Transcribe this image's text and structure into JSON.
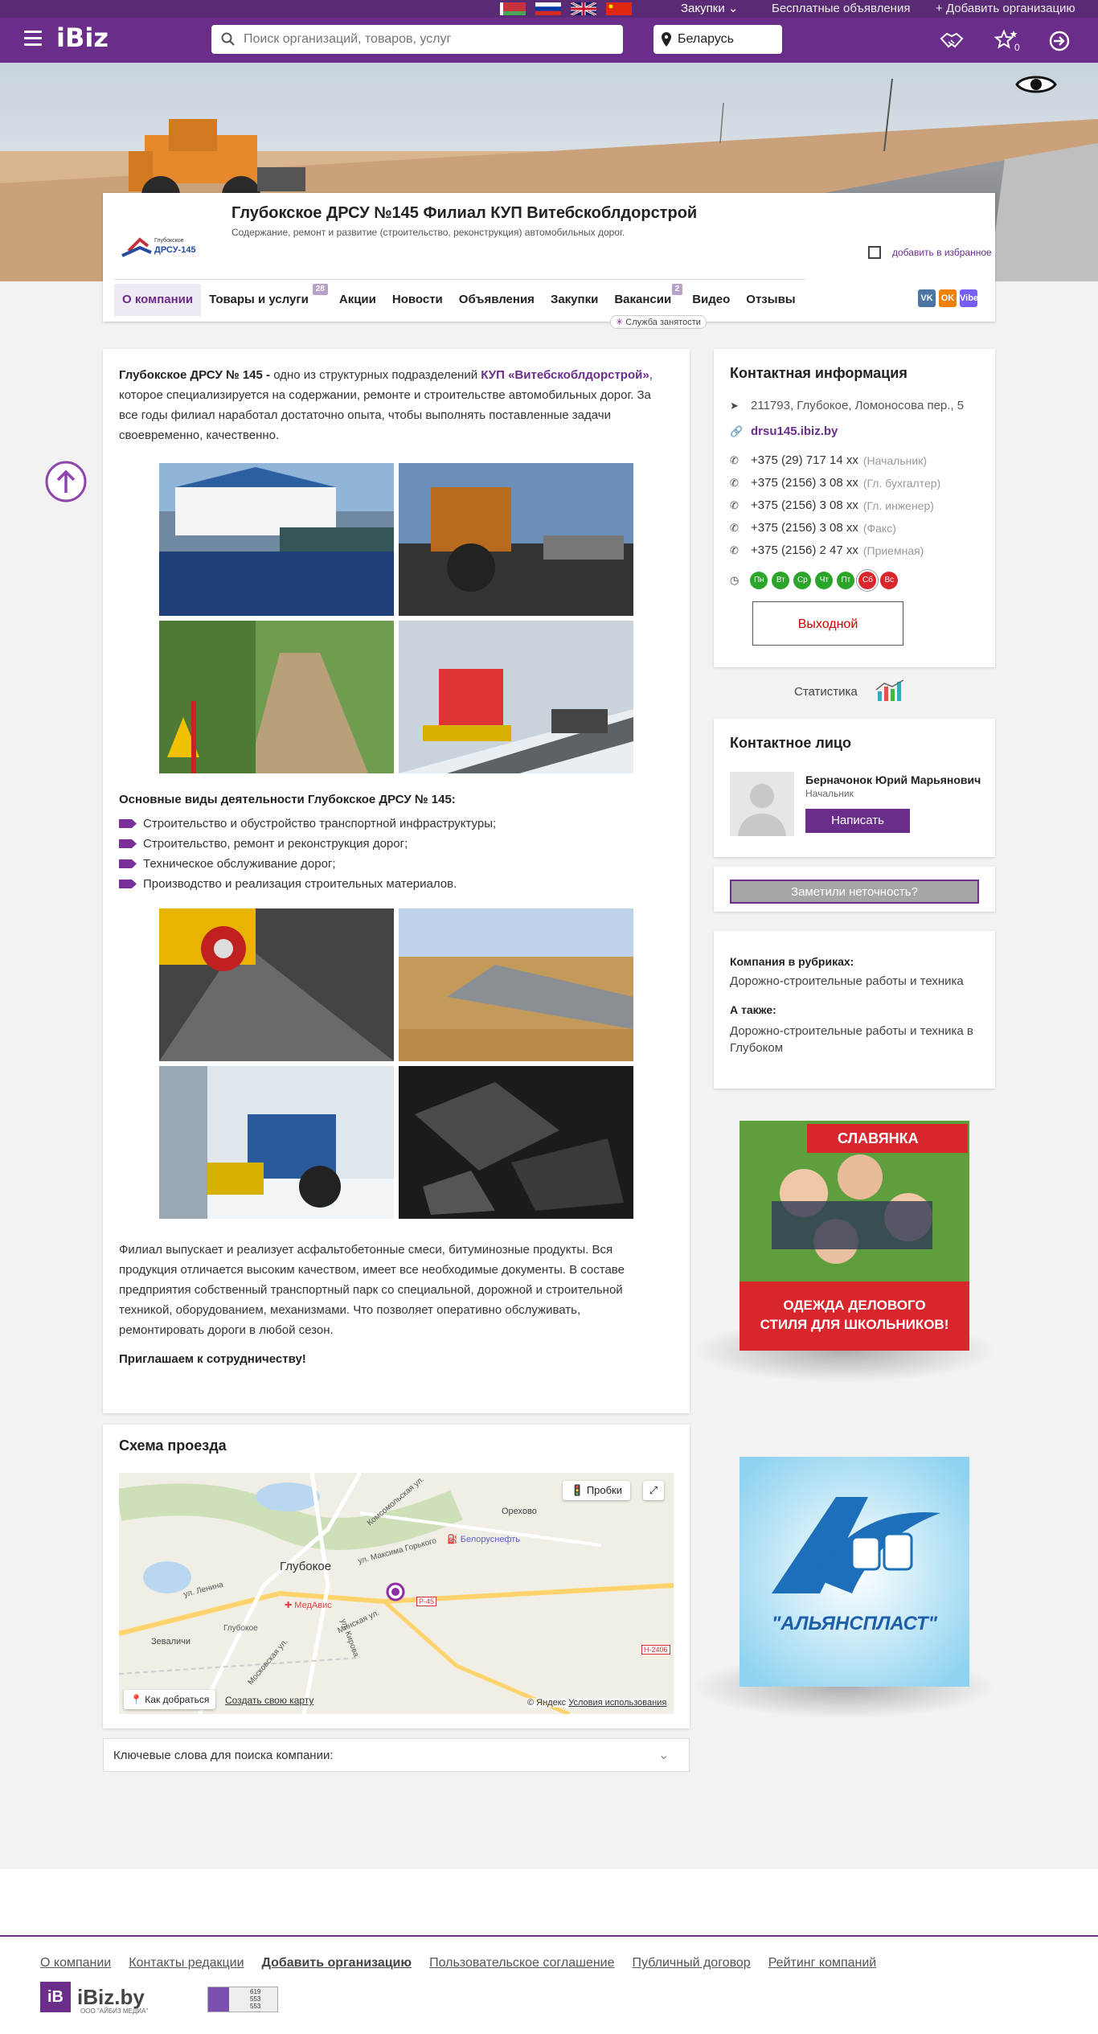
{
  "topbar": {
    "purchases": "Закупки",
    "free_ads": "Бесплатные объявления",
    "add_org": "Добавить организацию"
  },
  "header": {
    "logo": "iBiz",
    "search_placeholder": "Поиск организаций, товаров, услуг",
    "region": "Беларусь",
    "favorites_count": "0"
  },
  "company": {
    "title": "Глубокское ДРСУ №145 Филиал КУП Витебскоблдорстрой",
    "subtitle": "Содержание, ремонт и развитие (строительство, реконструкция) автомобильных дорог.",
    "logo_text_small": "Глубокское",
    "logo_text_big": "ДРСУ-145",
    "add_favorite": "добавить в избранное"
  },
  "tabs": [
    {
      "label": "О компании",
      "badge": ""
    },
    {
      "label": "Товары и услуги",
      "badge": "28"
    },
    {
      "label": "Акции",
      "badge": ""
    },
    {
      "label": "Новости",
      "badge": ""
    },
    {
      "label": "Объявления",
      "badge": ""
    },
    {
      "label": "Закупки",
      "badge": ""
    },
    {
      "label": "Вакансии",
      "badge": "2"
    },
    {
      "label": "Видео",
      "badge": ""
    },
    {
      "label": "Отзывы",
      "badge": ""
    }
  ],
  "tooltip": "Служба занятости",
  "socials": [
    "VK",
    "OK",
    "Viber"
  ],
  "about": {
    "lead_bold": "Глубокское ДРСУ № 145 -",
    "lead_pre": " одно из структурных подразделений ",
    "lead_link": "КУП «Витебскоблдорстрой»",
    "lead_post": ", которое специализируется на содержании, ремонте и строительстве автомобильных дорог. За все годы филиал наработал достаточно опыта, чтобы выполнять поставленные задачи своевременно, качественно.",
    "activities_title": "Основные виды деятельности Глубокское ДРСУ № 145:",
    "activities": [
      "Строительство и обустройство транспортной инфраструктуры;",
      "Строительство, ремонт и реконструкция дорог;",
      "Техническое обслуживание дорог;",
      "Производство и реализация строительных материалов."
    ],
    "products": "Филиал выпускает и реализует асфальтобетонные смеси, битуминозные продукты. Вся продукция отличается высоким качеством, имеет все необходимые документы. В составе предприятия собственный транспортный парк со специальной, дорожной и строительной техникой, оборудованием, механизмами. Что позволяет оперативно обслуживать, ремонтировать дороги в любой сезон.",
    "invite": "Приглашаем к сотрудничеству!"
  },
  "map": {
    "title": "Схема проезда",
    "traffic": "Пробки",
    "route": "Как добраться",
    "create_map": "Создать свою карту",
    "copyright": "© Яндекс",
    "terms": "Условия использования",
    "labels": {
      "city": "Глубокое",
      "station": "Глубокое",
      "village1": "Зеваличи",
      "village2": "Орехово",
      "fuel": "Белоруснефть",
      "clinic": "МедАвис",
      "road1": "Р-45",
      "road2": "Н-2406",
      "st1": "ул. Максима Горького",
      "st2": "Комсомольская ул.",
      "st3": "Минская ул.",
      "st4": "Московская ул.",
      "st5": "ул. Ленина",
      "st6": "ул. Кирова"
    }
  },
  "keywords": "Ключевые слова для поиска компании:",
  "contacts": {
    "title": "Контактная информация",
    "address": "211793, Глубокое, Ломоносова пер., 5",
    "site": "drsu145.ibiz.by",
    "phones": [
      {
        "number": "+375 (29) 717 14 xx",
        "note": "(Начальник)"
      },
      {
        "number": "+375 (2156) 3 08 xx",
        "note": "(Гл. бухгалтер)"
      },
      {
        "number": "+375 (2156) 3 08 xx",
        "note": "(Гл. инженер)"
      },
      {
        "number": "+375 (2156) 3 08 xx",
        "note": "(Факс)"
      },
      {
        "number": "+375 (2156) 2 47 xx",
        "note": "(Приемная)"
      }
    ],
    "days": [
      "Пн",
      "Вт",
      "Ср",
      "Чт",
      "Пт",
      "Сб",
      "Вс"
    ],
    "closed": "Выходной",
    "colors": {
      "work": "#2aa52a",
      "off": "#d9262c"
    }
  },
  "stats": "Статистика",
  "person": {
    "title": "Контактное лицо",
    "name": "Берначонок Юрий Марьянович",
    "role": "Начальник",
    "write": "Написать"
  },
  "error_report": "Заметили неточность?",
  "rubrics": {
    "in_label": "Компания в рубриках:",
    "in_value": "Дорожно-строительные работы и техника",
    "also_label": "А также:",
    "also_value": "Дорожно-строительные работы и техника в Глубоком"
  },
  "ads": {
    "slav_brand": "СЛАВЯНКА",
    "slav_text1": "ОДЕЖДА ДЕЛОВОГО",
    "slav_text2": "СТИЛЯ ДЛЯ ШКОЛЬНИКОВ!",
    "alyans": "\"АЛЬЯНСПЛАСТ\""
  },
  "footer": {
    "links": [
      "О компании",
      "Контакты редакции",
      "Добавить организацию",
      "Пользовательское соглашение",
      "Публичный договор",
      "Рейтинг компаний"
    ],
    "logo_box": "iB",
    "logo": "iBiz.by",
    "logo_sub": "ООО \"АЙБИЗ МЕДИА\"",
    "counter": [
      "619",
      "553",
      "553"
    ]
  },
  "colors": {
    "brand": "#6b2d8a",
    "top": "#5b2a74"
  }
}
